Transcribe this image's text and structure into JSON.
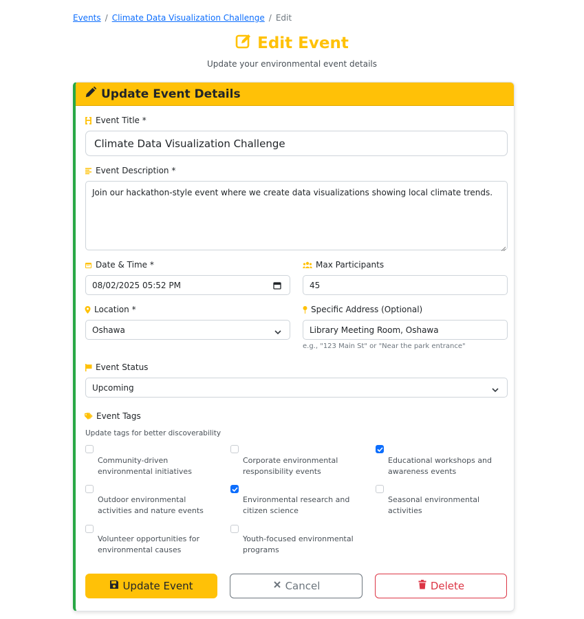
{
  "breadcrumb": {
    "items": [
      "Events",
      "Climate Data Visualization Challenge",
      "Edit"
    ],
    "separator": "/"
  },
  "header": {
    "title": "Edit Event",
    "subtitle": "Update your environmental event details",
    "icon": "edit-square-icon"
  },
  "card": {
    "title": "Update Event Details",
    "icon": "pencil-icon",
    "accent_color": "#ffc107",
    "border_color": "#28a745"
  },
  "form": {
    "title": {
      "label": "Event Title *",
      "value": "Climate Data Visualization Challenge",
      "icon": "heading-icon"
    },
    "description": {
      "label": "Event Description *",
      "value": "Join our hackathon-style event where we create data visualizations showing local climate trends.",
      "icon": "align-left-icon"
    },
    "datetime": {
      "label": "Date & Time *",
      "value": "08/02/2025 05:52 PM",
      "icon": "calendar-icon"
    },
    "max_participants": {
      "label": "Max Participants",
      "value": "45",
      "icon": "users-icon"
    },
    "location": {
      "label": "Location *",
      "value": "Oshawa",
      "icon": "map-marker-icon"
    },
    "address": {
      "label": "Specific Address (Optional)",
      "value": "Library Meeting Room, Oshawa",
      "help": "e.g., \"123 Main St\" or \"Near the park entrance\"",
      "icon": "pin-icon"
    },
    "status": {
      "label": "Event Status",
      "value": "Upcoming",
      "icon": "flag-icon"
    },
    "tags": {
      "label": "Event Tags",
      "help": "Update tags for better discoverability",
      "icon": "tags-icon",
      "items": [
        {
          "label": "Community-driven environmental initiatives",
          "checked": false
        },
        {
          "label": "Corporate environmental responsibility events",
          "checked": false
        },
        {
          "label": "Educational workshops and awareness events",
          "checked": true
        },
        {
          "label": "Outdoor environmental activities and nature events",
          "checked": false
        },
        {
          "label": "Environmental research and citizen science",
          "checked": true
        },
        {
          "label": "Seasonal environmental activities",
          "checked": false
        },
        {
          "label": "Volunteer opportunities for environmental causes",
          "checked": false
        },
        {
          "label": "Youth-focused environmental programs",
          "checked": false
        }
      ]
    }
  },
  "actions": {
    "update": "Update Event",
    "cancel": "Cancel",
    "delete": "Delete"
  },
  "colors": {
    "accent": "#ffc107",
    "primary": "#0d6efd",
    "danger": "#dc3545",
    "secondary": "#6c757d",
    "success": "#28a745"
  }
}
